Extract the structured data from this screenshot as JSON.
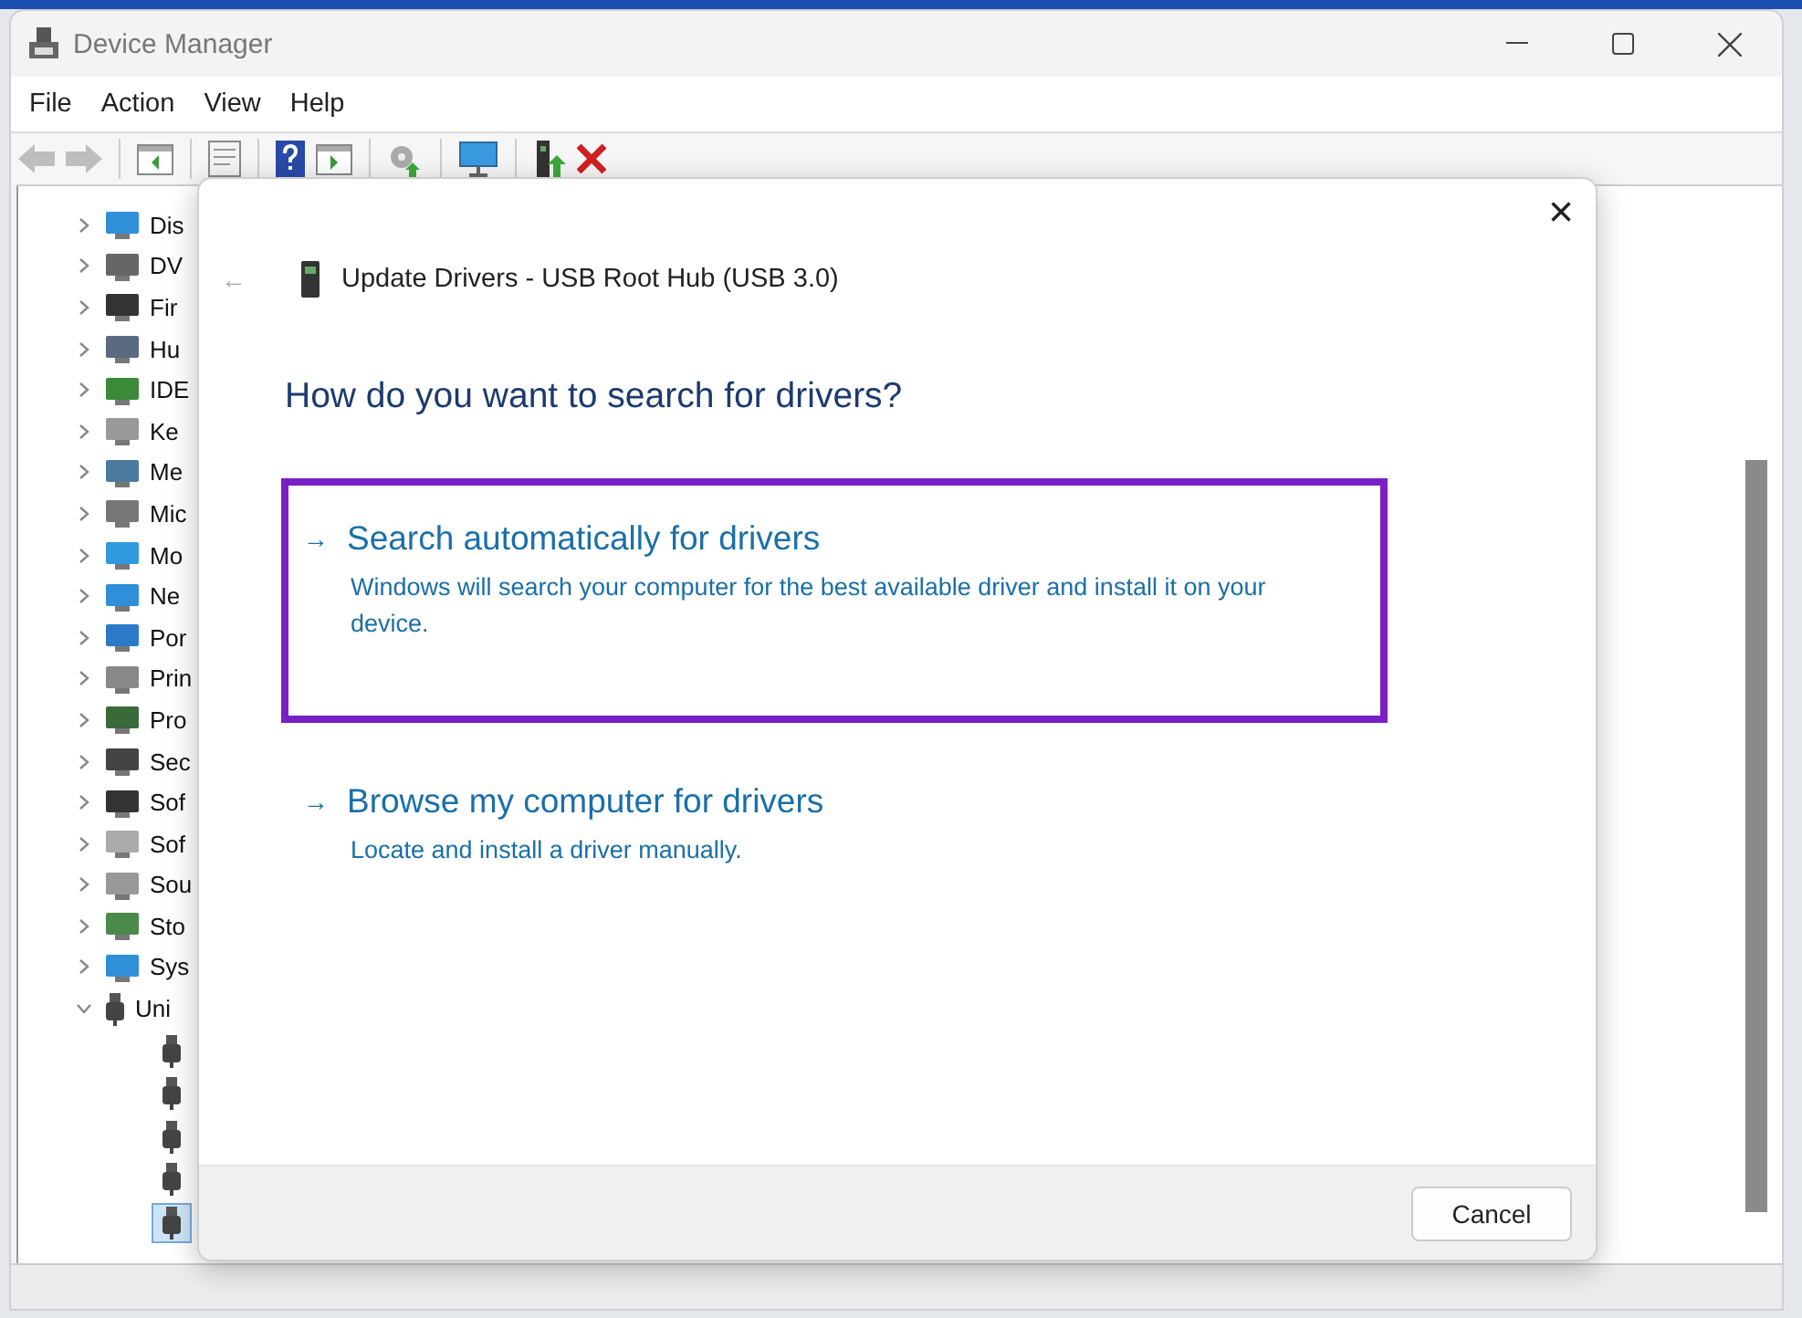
{
  "window": {
    "title": "Device Manager"
  },
  "menu": [
    "File",
    "Action",
    "View",
    "Help"
  ],
  "toolbar": [
    {
      "kind": "back",
      "disabled": true
    },
    {
      "kind": "forward",
      "disabled": true
    },
    {
      "kind": "sep"
    },
    {
      "kind": "console"
    },
    {
      "kind": "sep"
    },
    {
      "kind": "properties"
    },
    {
      "kind": "sep"
    },
    {
      "kind": "help"
    },
    {
      "kind": "view"
    },
    {
      "kind": "sep"
    },
    {
      "kind": "scan"
    },
    {
      "kind": "sep"
    },
    {
      "kind": "monitor"
    },
    {
      "kind": "sep"
    },
    {
      "kind": "update"
    },
    {
      "kind": "uninstall"
    }
  ],
  "tree": [
    {
      "label": "Dis",
      "expanded": false
    },
    {
      "label": "DV",
      "expanded": false
    },
    {
      "label": "Fir",
      "expanded": false
    },
    {
      "label": "Hu",
      "expanded": false
    },
    {
      "label": "IDE",
      "expanded": false
    },
    {
      "label": "Ke",
      "expanded": false
    },
    {
      "label": "Me",
      "expanded": false
    },
    {
      "label": "Mic",
      "expanded": false
    },
    {
      "label": "Mo",
      "expanded": false
    },
    {
      "label": "Ne",
      "expanded": false
    },
    {
      "label": "Por",
      "expanded": false
    },
    {
      "label": "Prin",
      "expanded": false
    },
    {
      "label": "Pro",
      "expanded": false
    },
    {
      "label": "Sec",
      "expanded": false
    },
    {
      "label": "Sof",
      "expanded": false
    },
    {
      "label": "Sof",
      "expanded": false
    },
    {
      "label": "Sou",
      "expanded": false
    },
    {
      "label": "Sto",
      "expanded": false
    },
    {
      "label": "Sys",
      "expanded": false
    },
    {
      "label": "Uni",
      "expanded": true,
      "children": [
        {
          "selected": false
        },
        {
          "selected": false
        },
        {
          "selected": false
        },
        {
          "selected": false
        },
        {
          "selected": true
        }
      ]
    }
  ],
  "dialog": {
    "back": "←",
    "close": "×",
    "title": "Update Drivers - USB Root Hub (USB 3.0)",
    "heading": "How do you want to search for drivers?",
    "options": [
      {
        "arrow": "→",
        "title": "Search automatically for drivers",
        "description": "Windows will search your computer for the best available driver and install it on your device.",
        "highlighted": true
      },
      {
        "arrow": "→",
        "title": "Browse my computer for drivers",
        "description": "Locate and install a driver manually.",
        "highlighted": false
      }
    ],
    "buttons": [
      "Cancel"
    ]
  }
}
